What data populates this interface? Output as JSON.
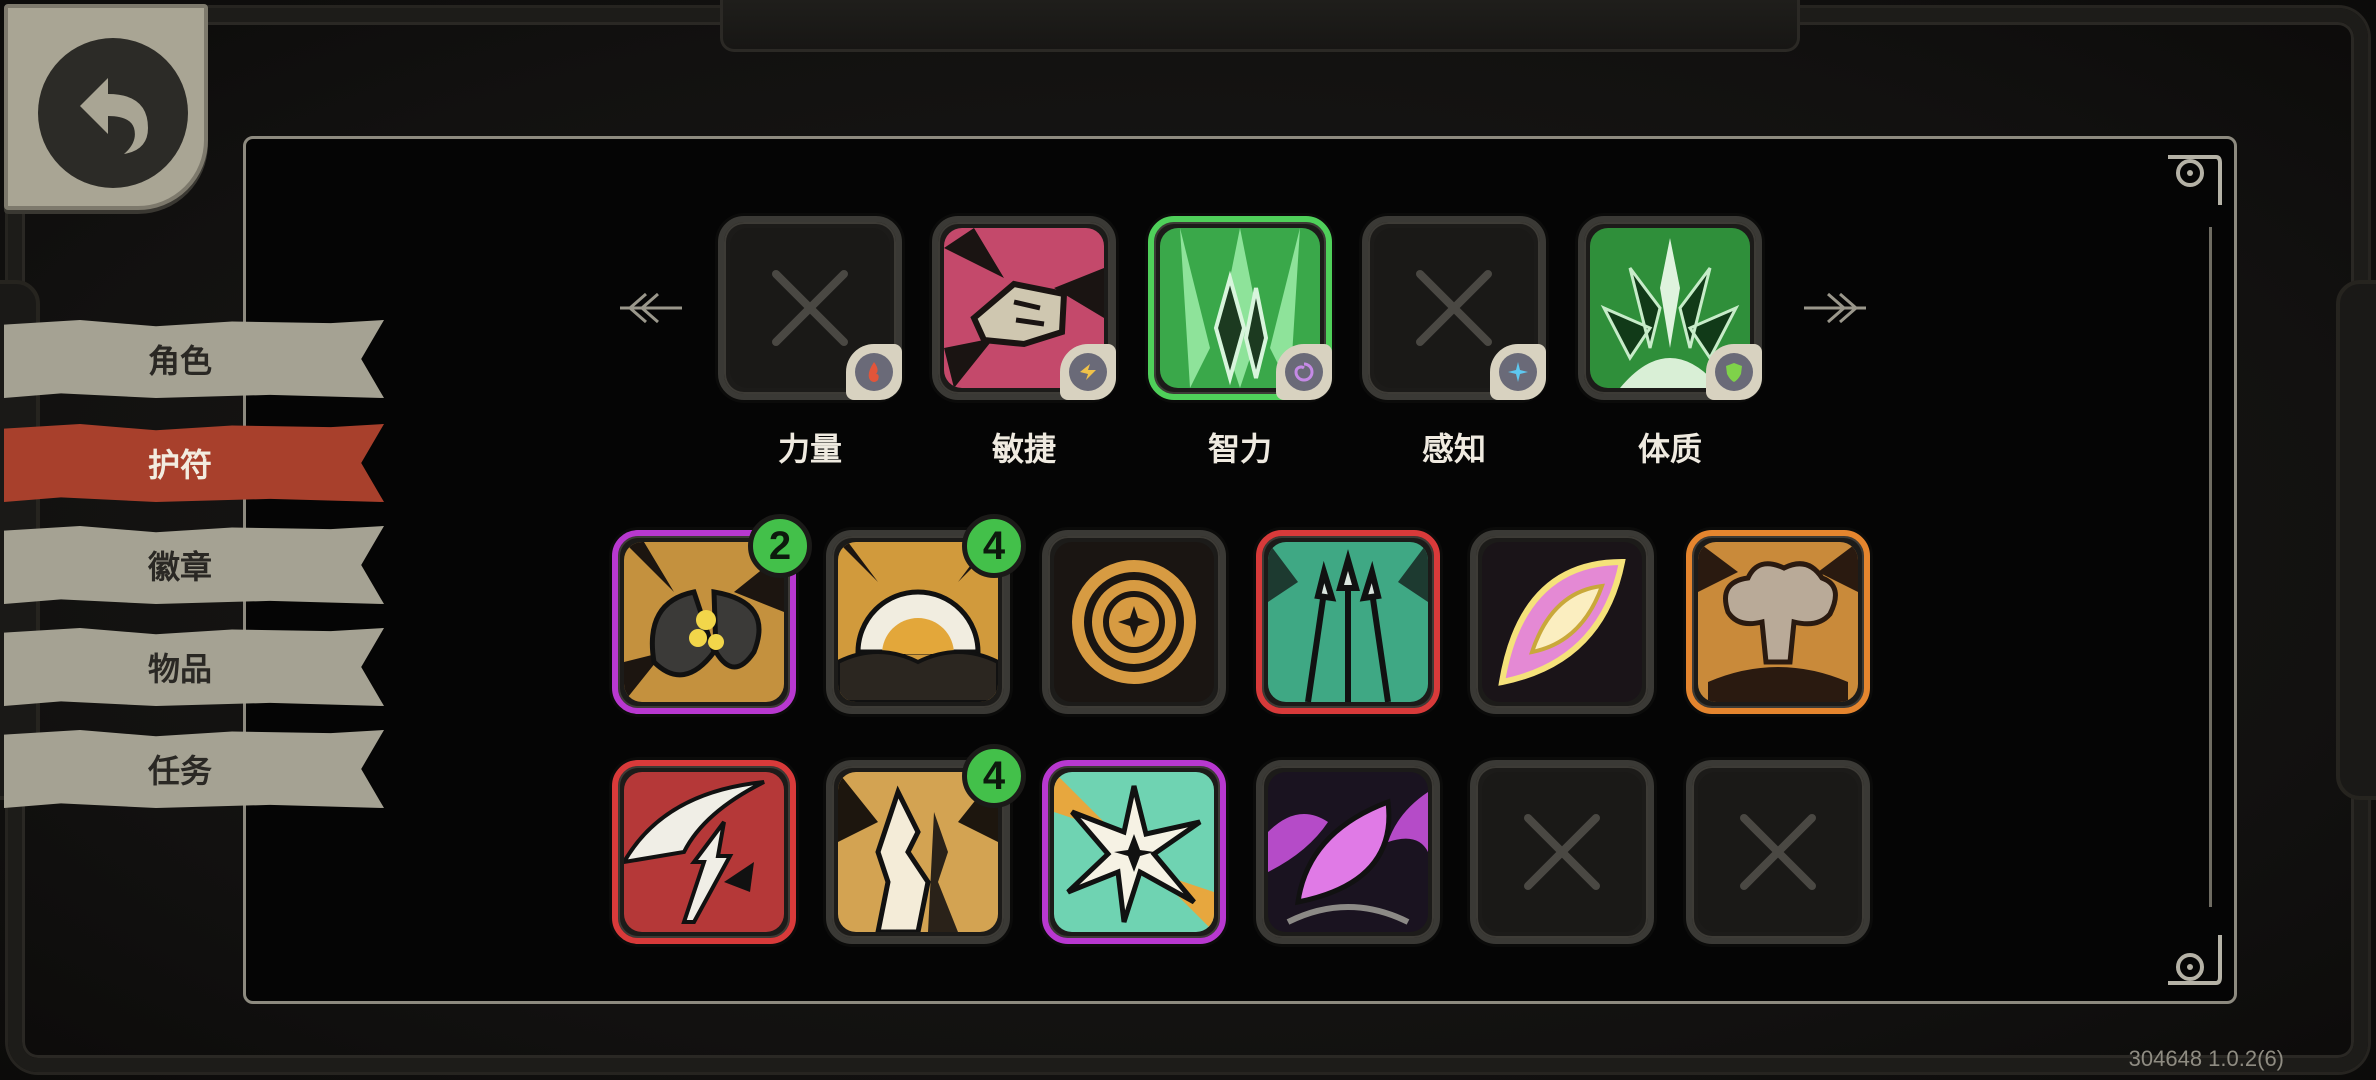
{
  "sidebar": {
    "tabs": [
      {
        "label": "角色",
        "active": false
      },
      {
        "label": "护符",
        "active": true
      },
      {
        "label": "徽章",
        "active": false
      },
      {
        "label": "物品",
        "active": false
      },
      {
        "label": "任务",
        "active": false
      }
    ]
  },
  "stat_slots": [
    {
      "label": "力量",
      "equipped": false,
      "stat_icon": "flame-icon"
    },
    {
      "label": "敏捷",
      "equipped": true,
      "stat_icon": "dash-icon"
    },
    {
      "label": "智力",
      "equipped": true,
      "stat_icon": "swirl-icon"
    },
    {
      "label": "感知",
      "equipped": false,
      "stat_icon": "star-icon"
    },
    {
      "label": "体质",
      "equipped": true,
      "stat_icon": "shield-icon"
    }
  ],
  "amulet_row_1": [
    {
      "badge": "2",
      "icon": "cracked-nut-icon"
    },
    {
      "badge": "4",
      "icon": "rising-sun-icon"
    },
    {
      "badge": "",
      "icon": "spiral-shield-icon"
    },
    {
      "badge": "",
      "icon": "spears-icon"
    },
    {
      "badge": "",
      "icon": "pink-crystal-icon"
    },
    {
      "badge": "",
      "icon": "explosion-cloud-icon"
    }
  ],
  "amulet_row_2": [
    {
      "badge": "",
      "icon": "lightning-arrow-icon"
    },
    {
      "badge": "4",
      "icon": "cracked-pillar-icon"
    },
    {
      "badge": "",
      "icon": "starburst-icon"
    },
    {
      "badge": "",
      "icon": "purple-larva-icon"
    },
    {
      "badge": "",
      "icon": "empty-slot-icon"
    },
    {
      "badge": "",
      "icon": "empty-slot-icon"
    }
  ],
  "version": "304648 1.0.2(6)"
}
